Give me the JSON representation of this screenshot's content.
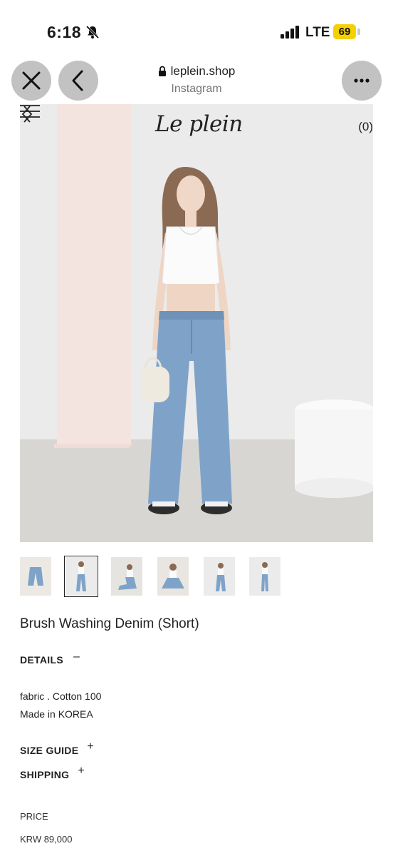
{
  "status": {
    "time": "6:18",
    "network": "LTE",
    "battery": "69",
    "icons": [
      "bell-slash-icon",
      "signal-icon",
      "battery-icon"
    ]
  },
  "browser": {
    "domain": "leplein.shop",
    "source": "Instagram",
    "icons": [
      "close-icon",
      "back-icon",
      "lock-icon",
      "more-icon"
    ]
  },
  "site": {
    "logo": "Le plein",
    "cart": "(0)",
    "icons": [
      "menu-icon",
      "chevron-left-icon",
      "chevron-right-icon"
    ]
  },
  "gallery": {
    "thumbnail_count": 6,
    "active_index": 1
  },
  "product": {
    "title": "Brush Washing Denim (Short)",
    "details_heading": "DETAILS",
    "details_toggle": "–",
    "fabric": "fabric . Cotton 100",
    "origin": "Made in KOREA",
    "size_guide_heading": "SIZE GUIDE",
    "size_guide_toggle": "+",
    "shipping_heading": "SHIPPING",
    "shipping_toggle": "+",
    "price_label": "PRICE",
    "price": "KRW 89,000"
  },
  "colors": {
    "battery": "#f5d100",
    "denim": "#7fa3c8",
    "backdrop": "#ececec"
  }
}
